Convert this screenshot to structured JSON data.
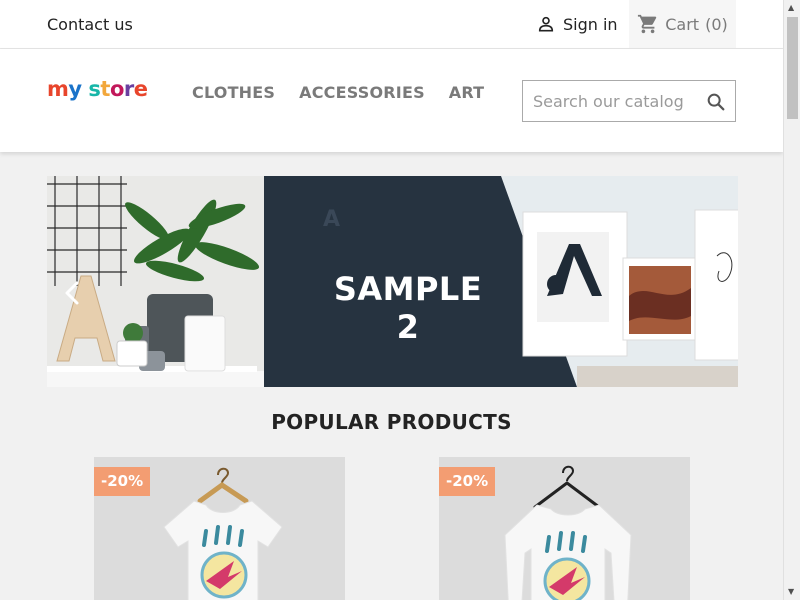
{
  "topnav": {
    "contact_label": "Contact us",
    "signin_label": "Sign in",
    "cart_label": "Cart",
    "cart_count": "(0)"
  },
  "header": {
    "logo": {
      "text": "my store"
    },
    "menu": [
      {
        "label": "CLOTHES"
      },
      {
        "label": "ACCESSORIES"
      },
      {
        "label": "ART"
      }
    ],
    "search": {
      "placeholder": "Search our catalog",
      "value": ""
    }
  },
  "slider": {
    "caption": "SAMPLE 2",
    "prev_icon": "chevron-left-icon",
    "next_icon": "chevron-right-icon"
  },
  "popular": {
    "title": "POPULAR PRODUCTS",
    "products": [
      {
        "badge": "-20%",
        "image": "tshirt-hummingbird"
      },
      {
        "badge": "-20%",
        "image": "sweater-hummingbird"
      }
    ]
  },
  "colors": {
    "accent": "#f39d72",
    "slide_dark": "#263340",
    "text": "#232323",
    "muted": "#7a7a7a"
  }
}
